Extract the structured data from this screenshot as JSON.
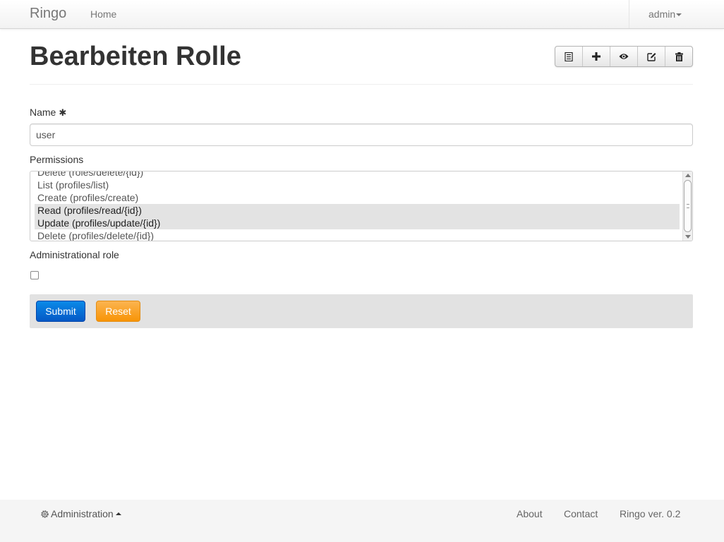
{
  "navbar": {
    "brand": "Ringo",
    "home": "Home",
    "user": "admin"
  },
  "page": {
    "title": "Bearbeiten Rolle",
    "toolbar_icons": [
      "list-icon",
      "plus-icon",
      "eye-icon",
      "edit-icon",
      "trash-icon"
    ]
  },
  "form": {
    "name_label": "Name",
    "name_required_mark": "✱",
    "name_value": "user",
    "permissions_label": "Permissions",
    "permissions_options": [
      {
        "label": "Delete (roles/delete/{id})",
        "selected": false
      },
      {
        "label": "List (profiles/list)",
        "selected": false
      },
      {
        "label": "Create (profiles/create)",
        "selected": false
      },
      {
        "label": "Read (profiles/read/{id})",
        "selected": true
      },
      {
        "label": "Update (profiles/update/{id})",
        "selected": true
      },
      {
        "label": "Delete (profiles/delete/{id})",
        "selected": false
      }
    ],
    "admin_role_label": "Administrational role",
    "admin_role_checked": false,
    "submit_label": "Submit",
    "reset_label": "Reset"
  },
  "footer": {
    "admin_menu": "Administration",
    "about": "About",
    "contact": "Contact",
    "version": "Ringo ver. 0.2"
  },
  "colors": {
    "submit": "#0459c6",
    "reset": "#f89406",
    "form_actions_bg": "#e2e2e2",
    "selected_option_bg": "#e3e3e3"
  }
}
